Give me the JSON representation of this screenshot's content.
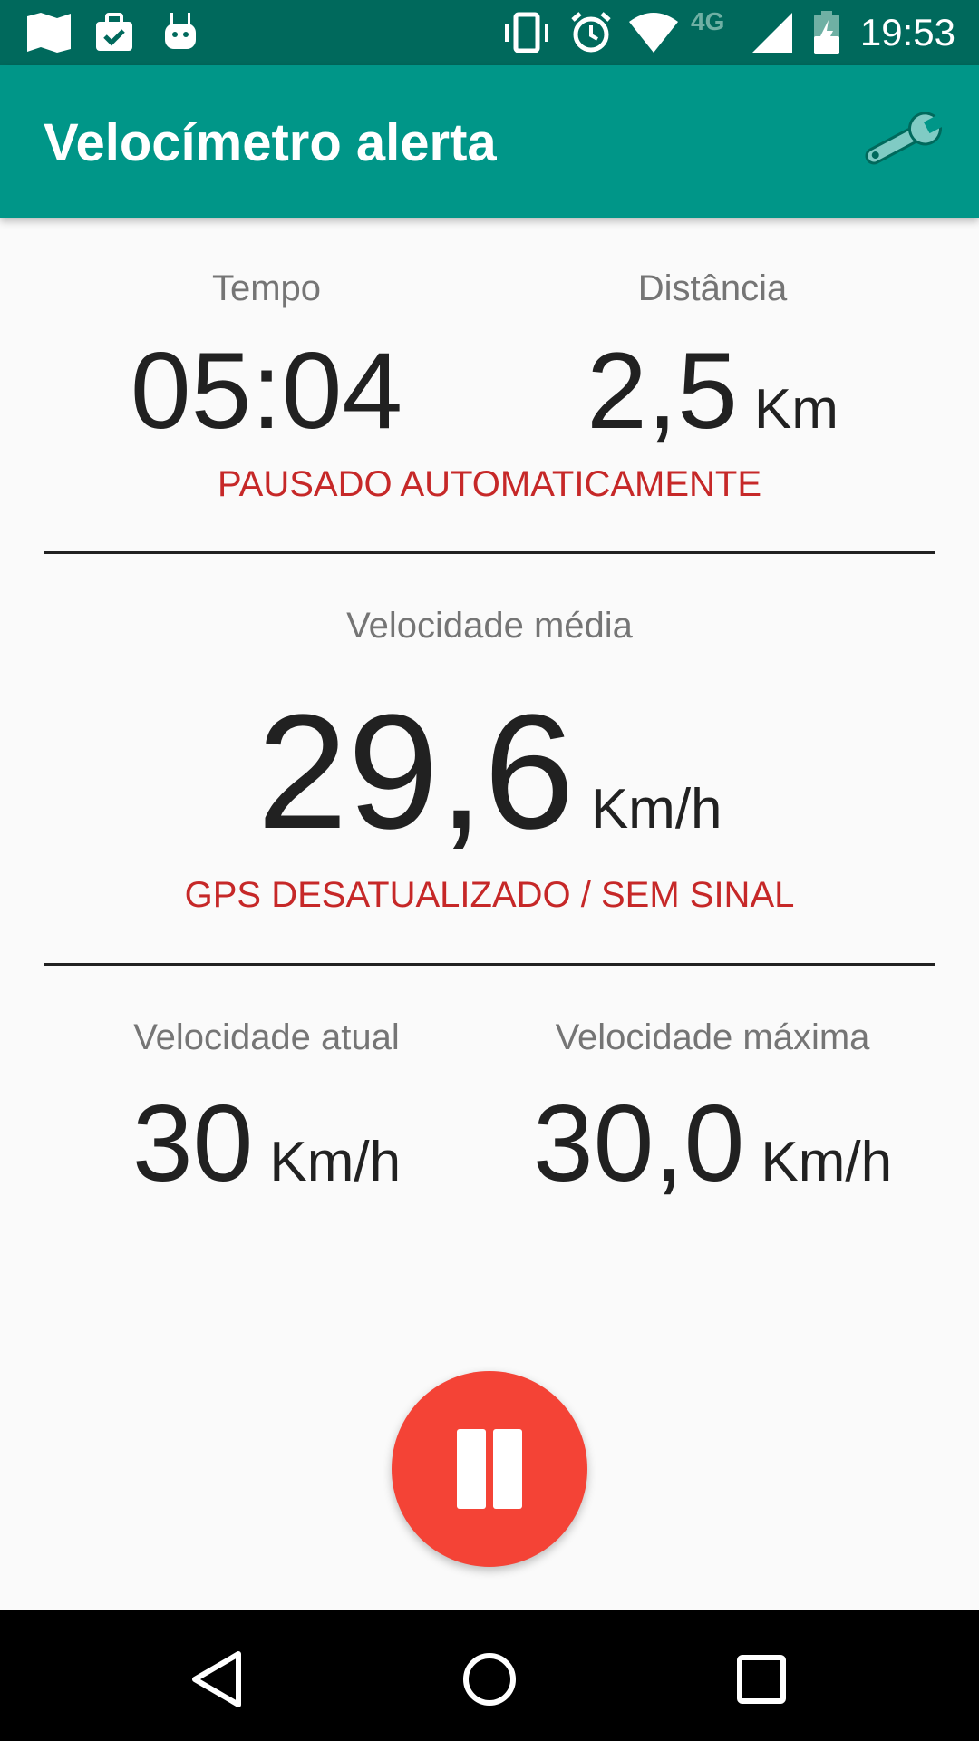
{
  "status_bar": {
    "time": "19:53",
    "network": "4G",
    "icons": [
      "map-icon",
      "briefcase-check-icon",
      "android-icon",
      "vibrate-icon",
      "alarm-icon",
      "wifi-icon",
      "signal-icon",
      "battery-icon"
    ]
  },
  "app_bar": {
    "title": "Velocímetro alerta",
    "settings_icon": "wrench-icon"
  },
  "metrics": {
    "time": {
      "label": "Tempo",
      "value": "05:04"
    },
    "distance": {
      "label": "Distância",
      "value": "2,5",
      "unit": "Km"
    },
    "status_paused": "PAUSADO AUTOMATICAMENTE",
    "average_speed": {
      "label": "Velocidade média",
      "value": "29,6",
      "unit": "Km/h"
    },
    "status_gps": "GPS DESATUALIZADO / SEM SINAL",
    "current_speed": {
      "label": "Velocidade atual",
      "value": "30",
      "unit": "Km/h"
    },
    "max_speed": {
      "label": "Velocidade máxima",
      "value": "30,0",
      "unit": "Km/h"
    }
  },
  "fab": {
    "icon": "pause-icon",
    "color": "#f44336"
  },
  "nav_bar": {
    "icons": [
      "back-icon",
      "home-icon",
      "recents-icon"
    ]
  },
  "colors": {
    "primary": "#009688",
    "primary_dark": "#00695c",
    "warning": "#c62828"
  }
}
